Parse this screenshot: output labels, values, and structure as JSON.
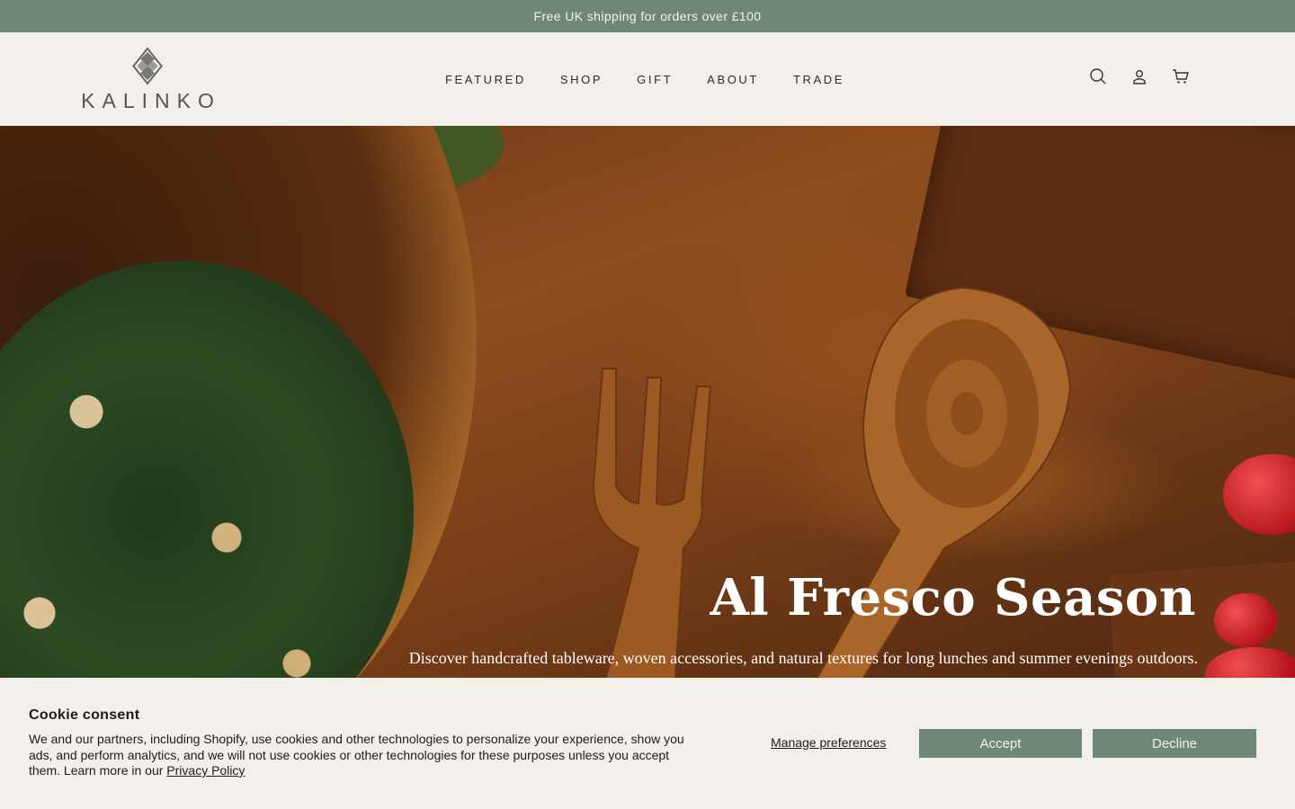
{
  "announcement": {
    "text": "Free UK shipping for orders over £100"
  },
  "brand": {
    "name": "KALINKO"
  },
  "nav": {
    "items": [
      {
        "label": "FEATURED"
      },
      {
        "label": "SHOP"
      },
      {
        "label": "GIFT"
      },
      {
        "label": "ABOUT"
      },
      {
        "label": "TRADE"
      }
    ]
  },
  "header_icons": [
    "search-icon",
    "account-icon",
    "cart-icon"
  ],
  "hero": {
    "title": "Al Fresco Season",
    "subtitle": "Discover handcrafted tableware, woven accessories, and natural textures for long lunches and summer evenings outdoors."
  },
  "cookie": {
    "title": "Cookie consent",
    "body": "We and our partners, including Shopify, use cookies and other technologies to personalize your experience, show you ads, and perform analytics, and we will not use cookies or other technologies for these purposes unless you accept them. Learn more in our ",
    "privacy_link": "Privacy Policy",
    "manage_label": "Manage preferences",
    "accept_label": "Accept",
    "decline_label": "Decline"
  },
  "colors": {
    "accent": "#6e8777",
    "background": "#f3f0eb",
    "text": "#1c1c1c"
  }
}
